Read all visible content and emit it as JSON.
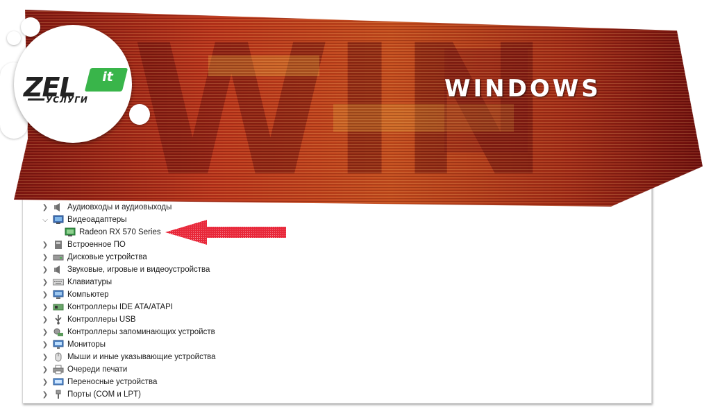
{
  "banner": {
    "title": "WINDOWS",
    "logo_main": "ZEL",
    "logo_badge": "it",
    "logo_sub": "УСЛУГИ",
    "colors": {
      "dark": "#6b0d0d",
      "mid": "#b8321a",
      "accent": "#e08a2a",
      "badge": "#39b54a"
    }
  },
  "device_manager": {
    "items": [
      {
        "label": "Аудиовходы и аудиовыходы",
        "expanded": false,
        "icon": "speaker-icon"
      },
      {
        "label": "Видеоадаптеры",
        "expanded": true,
        "icon": "display-adapter-icon"
      },
      {
        "label": "Radeon RX 570 Series",
        "child": true,
        "icon": "display-adapter-icon"
      },
      {
        "label": "Встроенное ПО",
        "expanded": false,
        "icon": "firmware-icon"
      },
      {
        "label": "Дисковые устройства",
        "expanded": false,
        "icon": "disk-drive-icon"
      },
      {
        "label": "Звуковые, игровые и видеоустройства",
        "expanded": false,
        "icon": "speaker-icon"
      },
      {
        "label": "Клавиатуры",
        "expanded": false,
        "icon": "keyboard-icon"
      },
      {
        "label": "Компьютер",
        "expanded": false,
        "icon": "computer-icon"
      },
      {
        "label": "Контроллеры IDE ATA/ATAPI",
        "expanded": false,
        "icon": "ide-controller-icon"
      },
      {
        "label": "Контроллеры USB",
        "expanded": false,
        "icon": "usb-icon"
      },
      {
        "label": "Контроллеры запоминающих устройств",
        "expanded": false,
        "icon": "storage-controller-icon"
      },
      {
        "label": "Мониторы",
        "expanded": false,
        "icon": "monitor-icon"
      },
      {
        "label": "Мыши и иные указывающие устройства",
        "expanded": false,
        "icon": "mouse-icon"
      },
      {
        "label": "Очереди печати",
        "expanded": false,
        "icon": "printer-icon"
      },
      {
        "label": "Переносные устройства",
        "expanded": false,
        "icon": "portable-device-icon"
      },
      {
        "label": "Порты (COM и LPT)",
        "expanded": false,
        "icon": "port-icon"
      }
    ]
  },
  "annotation": {
    "arrow_color": "#e8283a"
  }
}
